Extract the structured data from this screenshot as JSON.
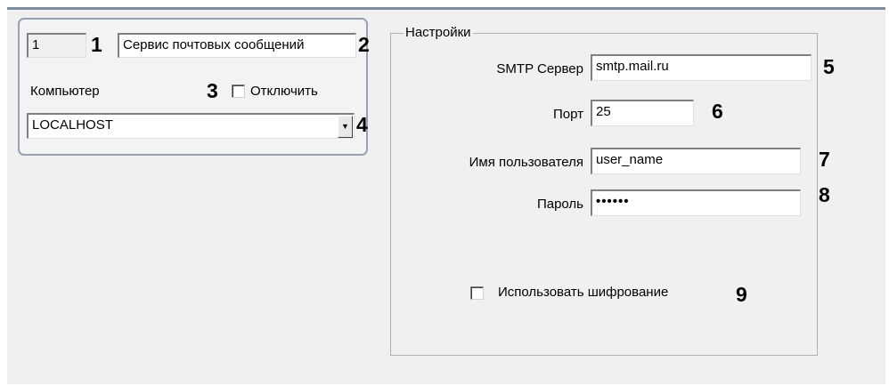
{
  "general": {
    "id_value": "1",
    "name_value": "Сервис почтовых сообщений",
    "computer_label": "Компьютер",
    "disable_label": "Отключить",
    "computer_value": "LOCALHOST",
    "dropdown_icon": "chevron-down-icon"
  },
  "settings": {
    "group_title": "Настройки",
    "smtp_label": "SMTP Сервер",
    "smtp_value": "smtp.mail.ru",
    "port_label": "Порт",
    "port_value": "25",
    "user_label": "Имя пользователя",
    "user_value": "user_name",
    "password_label": "Пароль",
    "password_value": "••••••",
    "encryption_label": "Использовать шифрование"
  },
  "callouts": {
    "n1": "1",
    "n2": "2",
    "n3": "3",
    "n4": "4",
    "n5": "5",
    "n6": "6",
    "n7": "7",
    "n8": "8",
    "n9": "9"
  }
}
